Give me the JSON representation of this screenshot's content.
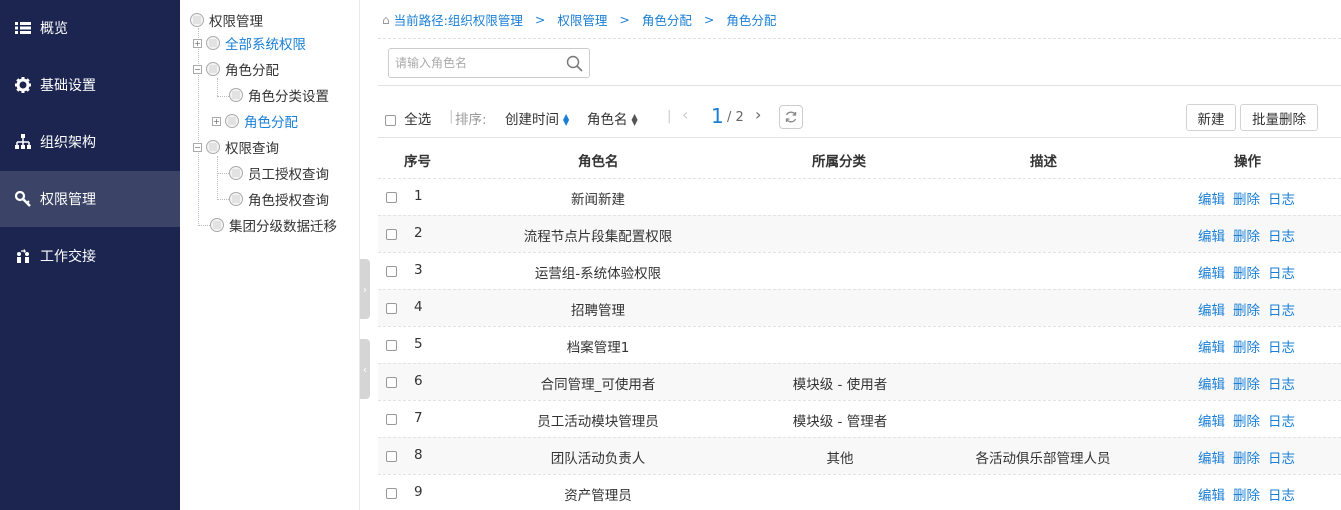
{
  "nav": {
    "items": [
      {
        "label": "概览",
        "icon": "list-icon"
      },
      {
        "label": "基础设置",
        "icon": "gear-icon"
      },
      {
        "label": "组织架构",
        "icon": "org-chart-icon"
      },
      {
        "label": "权限管理",
        "icon": "key-icon",
        "active": true
      },
      {
        "label": "工作交接",
        "icon": "handover-icon"
      }
    ]
  },
  "tree": {
    "root": "权限管理",
    "all_permissions": "全部系统权限",
    "role_assign": "角色分配",
    "role_category_settings": "角色分类设置",
    "role_assign_child": "角色分配",
    "permission_query": "权限查询",
    "employee_auth_query": "员工授权查询",
    "role_auth_query": "角色授权查询",
    "group_migration": "集团分级数据迁移"
  },
  "breadcrumb": {
    "prefix": "当前路径:",
    "items": [
      "组织权限管理",
      "权限管理",
      "角色分配",
      "角色分配"
    ],
    "separator": ">"
  },
  "search": {
    "placeholder": "请输入角色名",
    "value": ""
  },
  "toolbar": {
    "select_all": "全选",
    "sort_label": "排序:",
    "sort_created": "创建时间",
    "sort_name": "角色名",
    "page_current": "1",
    "page_total": "/ 2",
    "new_button": "新建",
    "batch_delete_button": "批量删除"
  },
  "table": {
    "headers": {
      "index": "序号",
      "name": "角色名",
      "category": "所属分类",
      "desc": "描述",
      "ops": "操作"
    },
    "op_labels": {
      "edit": "编辑",
      "delete": "删除",
      "log": "日志"
    },
    "rows": [
      {
        "index": "1",
        "name": "新闻新建",
        "category": "",
        "desc": ""
      },
      {
        "index": "2",
        "name": "流程节点片段集配置权限",
        "category": "",
        "desc": ""
      },
      {
        "index": "3",
        "name": "运营组-系统体验权限",
        "category": "",
        "desc": ""
      },
      {
        "index": "4",
        "name": "招聘管理",
        "category": "",
        "desc": ""
      },
      {
        "index": "5",
        "name": "档案管理1",
        "category": "",
        "desc": ""
      },
      {
        "index": "6",
        "name": "合同管理_可使用者",
        "category": "模块级 - 使用者",
        "desc": ""
      },
      {
        "index": "7",
        "name": "员工活动模块管理员",
        "category": "模块级 - 管理者",
        "desc": ""
      },
      {
        "index": "8",
        "name": "团队活动负责人",
        "category": "其他",
        "desc": "各活动俱乐部管理人员"
      },
      {
        "index": "9",
        "name": "资产管理员",
        "category": "",
        "desc": ""
      }
    ]
  },
  "colors": {
    "nav_bg": "#1b2550",
    "nav_active": "#3b4466",
    "link": "#1a7fd6"
  }
}
